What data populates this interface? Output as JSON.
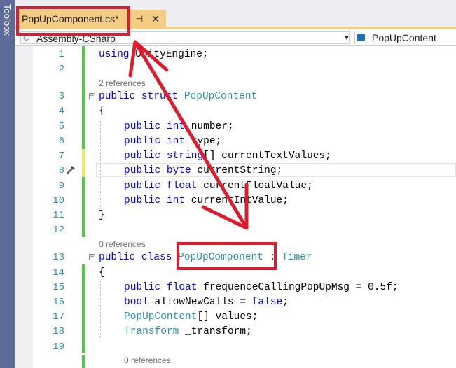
{
  "toolbox": {
    "label": "Toolbox"
  },
  "tab": {
    "title": "PopUpComponent.cs*",
    "pin_glyph": "⊣",
    "close_glyph": "✕"
  },
  "navbar": {
    "project": "Assembly-CSharp",
    "type": "PopUpContent",
    "dropdown_glyph": "▼"
  },
  "editor": {
    "line_numbers": [
      "1",
      "2",
      "3",
      "4",
      "5",
      "6",
      "7",
      "8",
      "9",
      "10",
      "11",
      "12",
      "13",
      "14",
      "15",
      "16",
      "17",
      "18",
      "19"
    ],
    "references": {
      "struct_refs": "2 references",
      "class_refs": "0 references",
      "field_refs": "0 references"
    },
    "lines": {
      "l1": {
        "kw": "using",
        "rest": " UnityEngine;"
      },
      "l3": {
        "kw1": "public",
        "kw2": "struct",
        "name": "PopUpContent"
      },
      "l4": "{",
      "l5": {
        "kw1": "public",
        "kw2": "int",
        "rest": " number;"
      },
      "l6": {
        "kw1": "public",
        "kw2": "int",
        "rest": " type;"
      },
      "l7": {
        "kw1": "public",
        "kw2": "string",
        "rest": "[] currentTextValues;"
      },
      "l8": {
        "kw1": "public",
        "kw2": "byte",
        "rest": " currentString;"
      },
      "l9": {
        "kw1": "public",
        "kw2": "float",
        "rest": " currentFloatValue;"
      },
      "l10": {
        "kw1": "public",
        "kw2": "int",
        "rest": " currentIntValue;"
      },
      "l11": "}",
      "l13": {
        "kw1": "public",
        "kw2": "class",
        "name": "PopUpComponent",
        "sep": " : ",
        "base": "Timer"
      },
      "l14": "{",
      "l15": {
        "kw1": "public",
        "kw2": "float",
        "rest": " frequenceCallingPopUpMsg = 0.5f;"
      },
      "l16": {
        "kw1": "bool",
        "rest1": " allowNewCalls = ",
        "kw2": "false",
        "rest2": ";"
      },
      "l17": {
        "type": "PopUpContent",
        "rest": "[] values;"
      },
      "l18": {
        "type": "Transform",
        "rest": " _transform;"
      }
    }
  },
  "colors": {
    "keyword": "#0000ff",
    "type": "#2b91af",
    "annotation_red": "#e01b2e",
    "tab_active": "#f5cc84",
    "change_saved": "#57c84d",
    "change_unsaved": "#efe571"
  }
}
